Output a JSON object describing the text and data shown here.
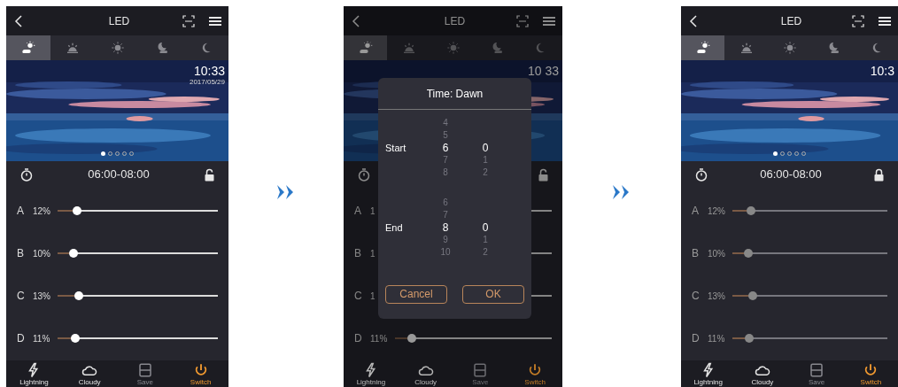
{
  "screens": [
    {
      "title": "LED",
      "locked": false,
      "weather_tabs": [
        {
          "kind": "sun-cloud",
          "selected": true
        },
        {
          "kind": "sunrise",
          "selected": false
        },
        {
          "kind": "sun",
          "selected": false
        },
        {
          "kind": "moon-cloud",
          "selected": false
        },
        {
          "kind": "moon",
          "selected": false
        }
      ],
      "clock": "10:33",
      "date": "2017/05/29",
      "pages": [
        {
          "selected": true
        },
        {
          "selected": false
        },
        {
          "selected": false
        },
        {
          "selected": false
        },
        {
          "selected": false
        }
      ],
      "time_range": "06:00-08:00",
      "channels": [
        {
          "label": "A",
          "reading": "12%",
          "level": 0.12
        },
        {
          "label": "B",
          "reading": "10%",
          "level": 0.1
        },
        {
          "label": "C",
          "reading": "13%",
          "level": 0.13
        },
        {
          "label": "D",
          "reading": "11%",
          "level": 0.11
        }
      ],
      "nav": [
        {
          "kind": "lightning",
          "label": "Lightning",
          "selected": false,
          "disabled": false
        },
        {
          "kind": "cloud",
          "label": "Cloudy",
          "selected": false,
          "disabled": false
        },
        {
          "kind": "save",
          "label": "Save",
          "selected": false,
          "disabled": true
        },
        {
          "kind": "power",
          "label": "Switch",
          "selected": true,
          "disabled": false
        }
      ]
    },
    {
      "title": "LED",
      "locked": false,
      "weather_tabs": [
        {
          "kind": "sun-cloud",
          "selected": true
        },
        {
          "kind": "sunrise",
          "selected": false
        },
        {
          "kind": "sun",
          "selected": false
        },
        {
          "kind": "moon-cloud",
          "selected": false
        },
        {
          "kind": "moon",
          "selected": false
        }
      ],
      "clock": "10 33",
      "channels": [
        {
          "label": "A",
          "reading": "1"
        },
        {
          "label": "B",
          "reading": "1"
        },
        {
          "label": "C",
          "reading": "1"
        },
        {
          "label": "D",
          "reading": "11%",
          "level": 0.11
        }
      ],
      "nav": [
        {
          "kind": "lightning",
          "label": "Lightning",
          "selected": false,
          "disabled": false
        },
        {
          "kind": "cloud",
          "label": "Cloudy",
          "selected": false,
          "disabled": false
        },
        {
          "kind": "save",
          "label": "Save",
          "selected": false,
          "disabled": true
        },
        {
          "kind": "power",
          "label": "Switch",
          "selected": true,
          "disabled": false
        }
      ],
      "dialog": {
        "title": "Time: Dawn",
        "pickers": [
          {
            "label": "Start",
            "hours": [
              {
                "value": "4",
                "selected": false
              },
              {
                "value": "5",
                "selected": false
              },
              {
                "value": "6",
                "selected": true
              },
              {
                "value": "7",
                "selected": false
              },
              {
                "value": "8",
                "selected": false
              }
            ],
            "minutes": [
              {
                "value": "0",
                "selected": true
              },
              {
                "value": "1",
                "selected": false
              },
              {
                "value": "2",
                "selected": false
              }
            ]
          },
          {
            "label": "End",
            "hours": [
              {
                "value": "6",
                "selected": false
              },
              {
                "value": "7",
                "selected": false
              },
              {
                "value": "8",
                "selected": true
              },
              {
                "value": "9",
                "selected": false
              },
              {
                "value": "10",
                "selected": false
              }
            ],
            "minutes": [
              {
                "value": "0",
                "selected": true
              },
              {
                "value": "1",
                "selected": false
              },
              {
                "value": "2",
                "selected": false
              }
            ]
          }
        ],
        "buttons": [
          "Cancel",
          "OK"
        ]
      }
    },
    {
      "title": "LED",
      "locked": true,
      "weather_tabs": [
        {
          "kind": "sun-cloud",
          "selected": true
        },
        {
          "kind": "sunrise",
          "selected": false
        },
        {
          "kind": "sun",
          "selected": false
        },
        {
          "kind": "moon-cloud",
          "selected": false
        },
        {
          "kind": "moon",
          "selected": false
        }
      ],
      "clock": "10:3",
      "pages": [
        {
          "selected": true
        },
        {
          "selected": false
        },
        {
          "selected": false
        },
        {
          "selected": false
        },
        {
          "selected": false
        }
      ],
      "time_range": "06:00-08:00",
      "channels": [
        {
          "label": "A",
          "reading": "12%",
          "level": 0.12
        },
        {
          "label": "B",
          "reading": "10%",
          "level": 0.1
        },
        {
          "label": "C",
          "reading": "13%",
          "level": 0.13
        },
        {
          "label": "D",
          "reading": "11%",
          "level": 0.11
        }
      ],
      "nav": [
        {
          "kind": "lightning",
          "label": "Lightning",
          "selected": false,
          "disabled": false
        },
        {
          "kind": "cloud",
          "label": "Cloudy",
          "selected": false,
          "disabled": false
        },
        {
          "kind": "save",
          "label": "Save",
          "selected": false,
          "disabled": true
        },
        {
          "kind": "power",
          "label": "Switch",
          "selected": true,
          "disabled": false
        }
      ]
    }
  ]
}
